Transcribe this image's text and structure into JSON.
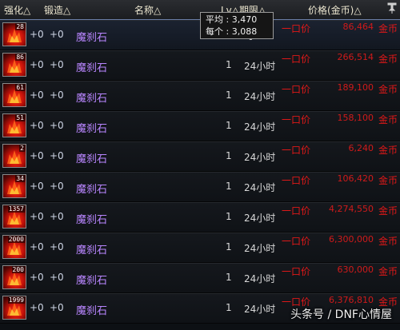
{
  "header": {
    "col_enhance": "强化△",
    "col_forge": "锻造△",
    "col_name": "名称△",
    "col_lv_period": "Lv△期限△",
    "col_price": "价格(金币)△",
    "pin_icon": "pin-icon"
  },
  "tooltip": {
    "avg_label": "平均 : 3,470",
    "each_label": "每个 : 3,088"
  },
  "rows": [
    {
      "qty": "28",
      "enh": "+0",
      "forge": "+0",
      "name": "魔刹石",
      "lv": "",
      "period": "时",
      "buy": "一口价",
      "price": "86,464",
      "currency": "金币"
    },
    {
      "qty": "86",
      "enh": "+0",
      "forge": "+0",
      "name": "魔刹石",
      "lv": "1",
      "period": "24小时",
      "buy": "一口价",
      "price": "266,514",
      "currency": "金币"
    },
    {
      "qty": "61",
      "enh": "+0",
      "forge": "+0",
      "name": "魔刹石",
      "lv": "1",
      "period": "24小时",
      "buy": "一口价",
      "price": "189,100",
      "currency": "金币"
    },
    {
      "qty": "51",
      "enh": "+0",
      "forge": "+0",
      "name": "魔刹石",
      "lv": "1",
      "period": "24小时",
      "buy": "一口价",
      "price": "158,100",
      "currency": "金币"
    },
    {
      "qty": "2",
      "enh": "+0",
      "forge": "+0",
      "name": "魔刹石",
      "lv": "1",
      "period": "24小时",
      "buy": "一口价",
      "price": "6,240",
      "currency": "金币"
    },
    {
      "qty": "34",
      "enh": "+0",
      "forge": "+0",
      "name": "魔刹石",
      "lv": "1",
      "period": "24小时",
      "buy": "一口价",
      "price": "106,420",
      "currency": "金币"
    },
    {
      "qty": "1357",
      "enh": "+0",
      "forge": "+0",
      "name": "魔刹石",
      "lv": "1",
      "period": "24小时",
      "buy": "一口价",
      "price": "4,274,550",
      "currency": "金币"
    },
    {
      "qty": "2000",
      "enh": "+0",
      "forge": "+0",
      "name": "魔刹石",
      "lv": "1",
      "period": "24小时",
      "buy": "一口价",
      "price": "6,300,000",
      "currency": "金币"
    },
    {
      "qty": "200",
      "enh": "+0",
      "forge": "+0",
      "name": "魔刹石",
      "lv": "1",
      "period": "24小时",
      "buy": "一口价",
      "price": "630,000",
      "currency": "金币"
    },
    {
      "qty": "1999",
      "enh": "+0",
      "forge": "+0",
      "name": "魔刹石",
      "lv": "1",
      "period": "24小时",
      "buy": "一口价",
      "price": "6,376,810",
      "currency": "金币"
    }
  ],
  "watermark": "头条号 / DNF心情屋",
  "colors": {
    "price_red": "#d01a1a",
    "name_purple": "#b986ff"
  }
}
